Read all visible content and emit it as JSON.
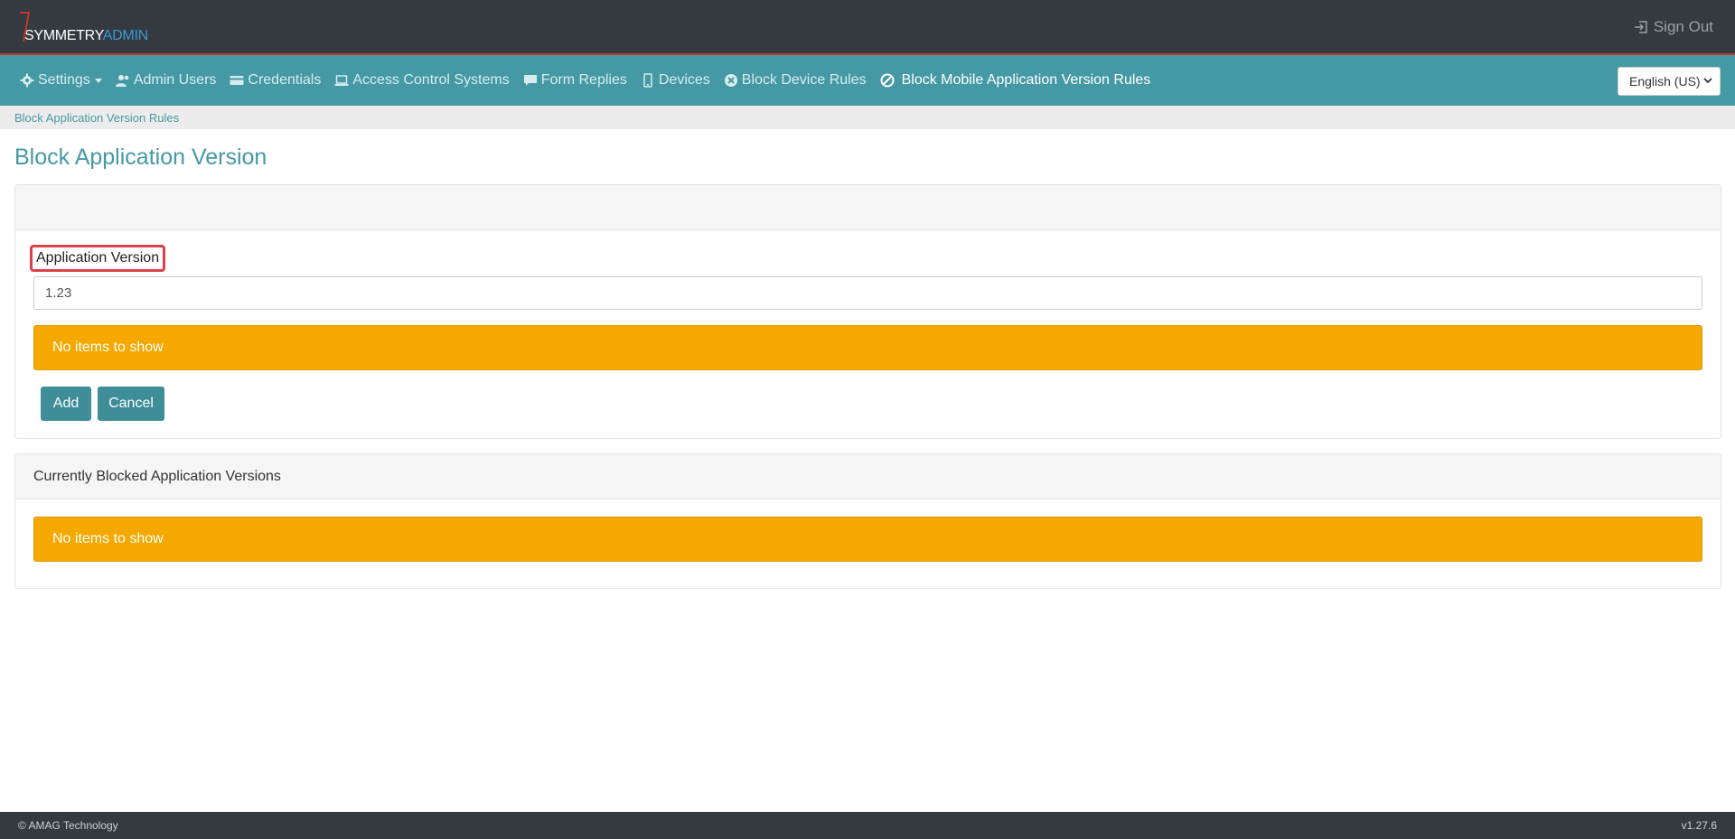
{
  "header": {
    "logo_main": "SYMMETRY",
    "logo_accent": "ADMIN",
    "sign_out_label": "Sign Out"
  },
  "nav": {
    "items": [
      {
        "label": "Settings",
        "icon": "gear-icon"
      },
      {
        "label": "Admin Users",
        "icon": "users-icon"
      },
      {
        "label": "Credentials",
        "icon": "credit-card-icon"
      },
      {
        "label": "Access Control Systems",
        "icon": "laptop-icon"
      },
      {
        "label": "Form Replies",
        "icon": "comment-icon"
      },
      {
        "label": "Devices",
        "icon": "mobile-icon"
      },
      {
        "label": "Block Device Rules",
        "icon": "times-circle-icon"
      },
      {
        "label": "Block Mobile Application Version Rules",
        "icon": "ban-icon"
      }
    ],
    "language": "English (US)"
  },
  "breadcrumb": {
    "current": "Block Application Version Rules"
  },
  "page": {
    "title": "Block Application Version"
  },
  "form": {
    "field_label": "Application Version",
    "field_value": "1.23",
    "alert_text": "No items to show",
    "add_label": "Add",
    "cancel_label": "Cancel"
  },
  "blocked": {
    "heading": "Currently Blocked Application Versions",
    "alert_text": "No items to show"
  },
  "footer": {
    "copyright": "© AMAG Technology",
    "version": "v1.27.6"
  },
  "colors": {
    "navbar": "#4599a5",
    "header": "#343a40",
    "alert": "#f5a800",
    "button": "#3e8d98"
  }
}
